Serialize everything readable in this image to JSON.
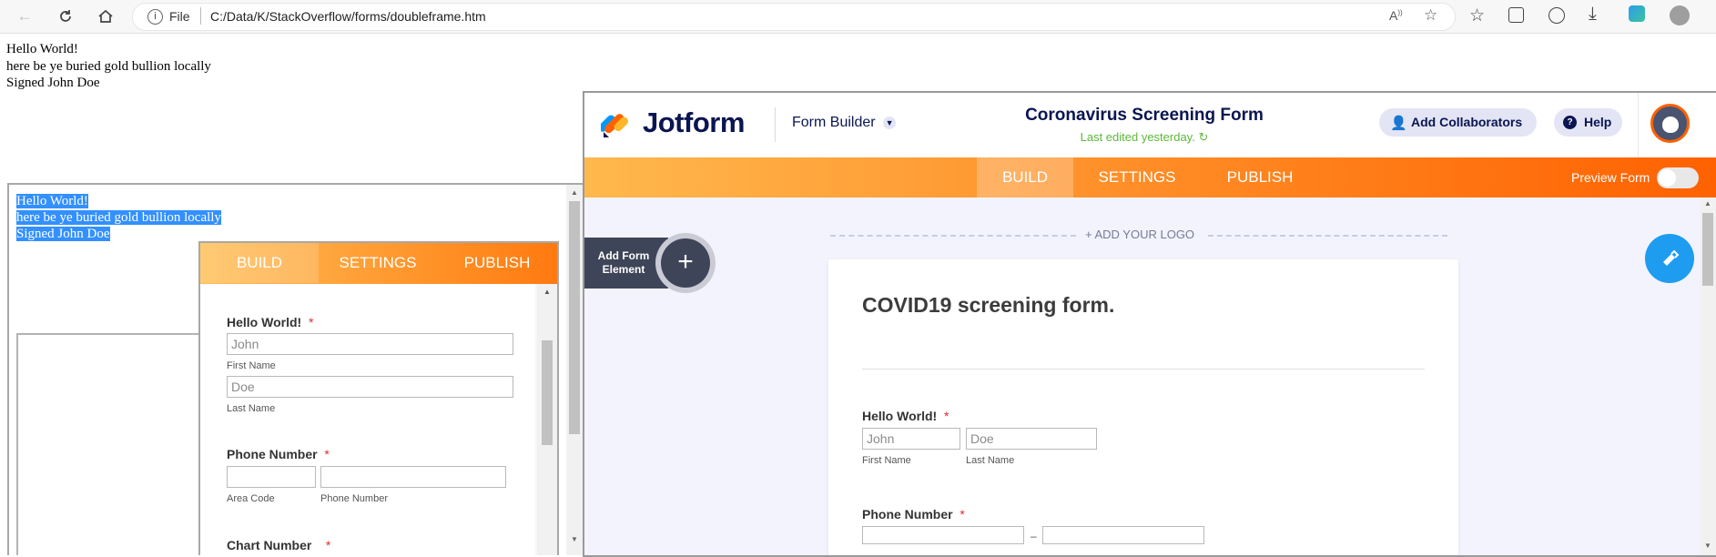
{
  "browser": {
    "file_label": "File",
    "url": "C:/Data/K/StackOverflow/forms/doubleframe.htm"
  },
  "page": {
    "lines": [
      "Hello World!",
      "here be ye buried gold bullion locally",
      "Signed John Doe"
    ]
  },
  "inner_frame": {
    "selected_lines": [
      "Hello World!",
      "here be ye buried gold bullion locally",
      "Signed John Doe"
    ],
    "tabs": [
      "BUILD",
      "SETTINGS",
      "PUBLISH"
    ],
    "form": {
      "q1_label": "Hello World!",
      "first_value": "John",
      "first_sub": "First Name",
      "last_value": "Doe",
      "last_sub": "Last Name",
      "phone_label": "Phone Number",
      "area_sub": "Area Code",
      "phone_sub": "Phone Number",
      "chart_label": "Chart Number",
      "required_mark": "*"
    }
  },
  "jotform": {
    "logo_text": "Jotform",
    "form_builder": "Form Builder",
    "form_title": "Coronavirus Screening Form",
    "last_edited": "Last edited yesterday.",
    "add_collaborators": "Add Collaborators",
    "help": "Help",
    "tabs": [
      "BUILD",
      "SETTINGS",
      "PUBLISH"
    ],
    "preview_form": "Preview Form",
    "add_logo": "+ ADD YOUR LOGO",
    "add_element": "Add Form Element",
    "form": {
      "heading": "COVID19 screening form.",
      "q1_label": "Hello World!",
      "first_value": "John",
      "first_sub": "First Name",
      "last_value": "Doe",
      "last_sub": "Last Name",
      "phone_label": "Phone Number",
      "required_mark": "*"
    }
  },
  "colors": {
    "orange_start": "#ffb84d",
    "orange_end": "#ff6100",
    "jotform_navy": "#0a1551",
    "selection": "#3390ff",
    "edit_button": "#1e9cf0"
  }
}
